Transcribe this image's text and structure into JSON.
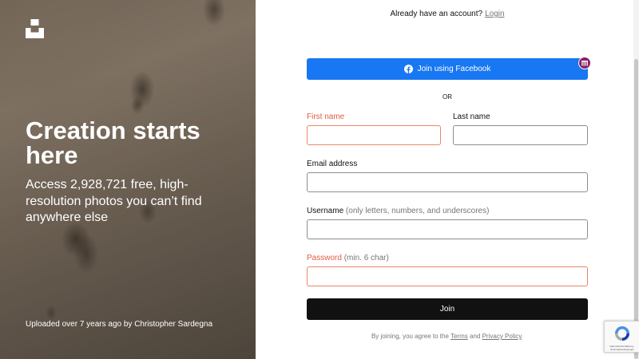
{
  "hero": {
    "title": "Creation starts here",
    "subtitle": "Access 2,928,721 free, high-resolution photos you can’t find anywhere else",
    "credit": "Uploaded over 7 years ago by Christopher Sardegna"
  },
  "header": {
    "signin_prompt": "Already have an account?",
    "signin_link": "Login"
  },
  "form": {
    "facebook_button": "Join using Facebook",
    "or_divider": "OR",
    "first_name_label": "First name",
    "first_name_value": "",
    "last_name_label": "Last name",
    "last_name_value": "",
    "email_label": "Email address",
    "email_value": "",
    "username_label": "Username",
    "username_hint": "(only letters, numbers, and underscores)",
    "username_value": "",
    "password_label": "Password",
    "password_hint": "(min. 6 char)",
    "password_value": "",
    "join_button": "Join"
  },
  "footer": {
    "terms_prefix": "By joining, you agree to the",
    "terms_link": "Terms",
    "terms_and": "and",
    "privacy_link": "Privacy Policy",
    "terms_suffix": "."
  },
  "recaptcha": {
    "label": "Datenschutzerklärung - Nutzungsbedingungen"
  },
  "icons": {
    "logo": "unsplash-logo-icon",
    "facebook": "facebook-icon",
    "extension": "grid-badge-icon",
    "recaptcha": "recaptcha-icon"
  },
  "colors": {
    "facebook_blue": "#1877f2",
    "join_black": "#111111",
    "error_red": "#e25c3d",
    "badge_purple": "#8a1f6a"
  }
}
